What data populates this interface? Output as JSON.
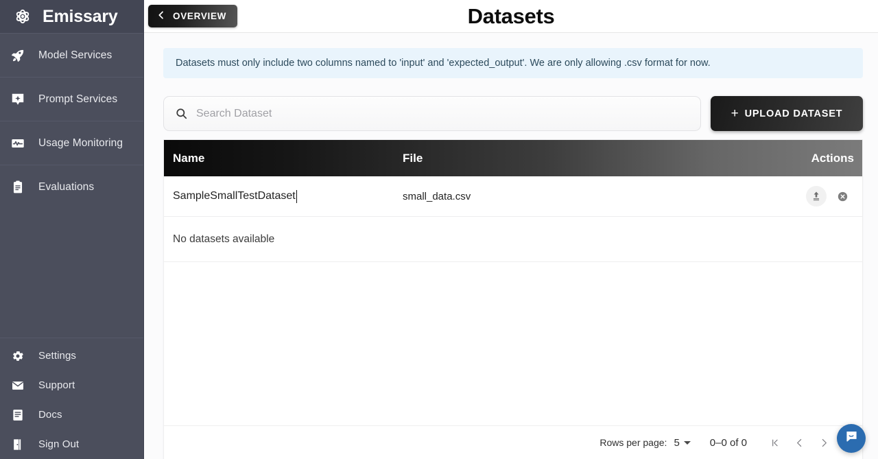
{
  "sidebar": {
    "brand_name": "Emissary",
    "brand_logo_icon": "atom-flower-logo-icon",
    "primary_items": [
      {
        "label": "Model Services",
        "icon": "rocket-icon"
      },
      {
        "label": "Prompt Services",
        "icon": "sparkle-badge-icon"
      },
      {
        "label": "Usage Monitoring",
        "icon": "activity-chart-icon"
      },
      {
        "label": "Evaluations",
        "icon": "clipboard-icon"
      }
    ],
    "secondary_items": [
      {
        "label": "Settings",
        "icon": "gear-icon"
      },
      {
        "label": "Support",
        "icon": "envelope-icon"
      },
      {
        "label": "Docs",
        "icon": "document-lines-icon"
      },
      {
        "label": "Sign Out",
        "icon": "sign-out-door-icon"
      }
    ]
  },
  "topbar": {
    "back_label": "OVERVIEW",
    "back_icon": "chevron-left-icon",
    "page_title": "Datasets"
  },
  "banner": {
    "text": "Datasets must only include two columns named to 'input' and 'expected_output'. We are only allowing .csv format for now."
  },
  "search": {
    "placeholder": "Search Dataset",
    "value": "",
    "icon": "search-icon"
  },
  "upload_button": {
    "label": "UPLOAD DATASET",
    "plus": "+"
  },
  "table": {
    "headers": {
      "name": "Name",
      "file": "File",
      "actions": "Actions"
    },
    "rows": [
      {
        "name": "SampleSmallTestDataset",
        "file": "small_data.csv",
        "upload_icon": "upload-arrow-icon",
        "delete_icon": "remove-circle-icon"
      }
    ],
    "empty_message": "No datasets available"
  },
  "pagination": {
    "rows_per_page_label": "Rows per page:",
    "rows_per_page_value": "5",
    "range_label": "0–0 of 0",
    "first_icon": "first-page-icon",
    "prev_icon": "previous-page-icon",
    "next_icon": "next-page-icon",
    "last_icon": "last-page-icon"
  },
  "chat_widget": {
    "icon": "chat-bubble-icon"
  },
  "colors": {
    "sidebar_bg": "#4b4e5c",
    "banner_bg": "#e9f4fc",
    "accent_dark": "#121212",
    "chat_blue": "#2b6cb0"
  }
}
